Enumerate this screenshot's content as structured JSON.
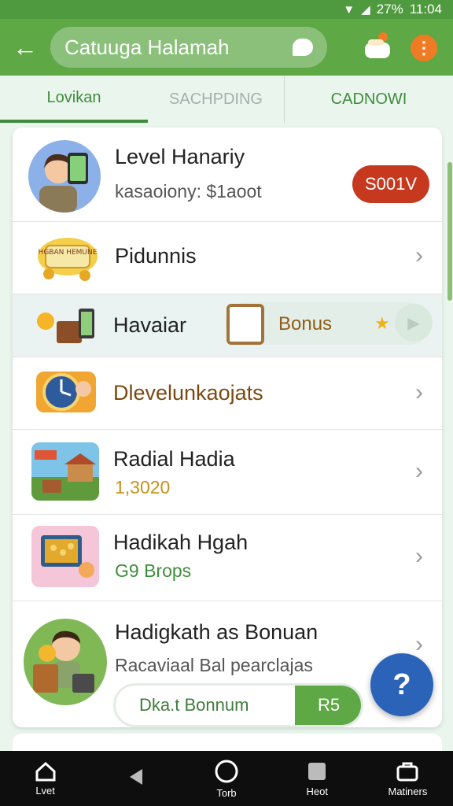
{
  "status_bar": {
    "battery": "27%",
    "time": "11:04"
  },
  "app_bar": {
    "search_text": "Catuuga Halamah"
  },
  "tabs": [
    {
      "label": "Lovikan"
    },
    {
      "label": "SACHPDING"
    },
    {
      "label": "CADNOWI"
    }
  ],
  "rows": [
    {
      "title": "Level Hanariy",
      "subtitle": "kasaoiony: $1aoot",
      "badge": "S001V"
    },
    {
      "title": "Pidunnis"
    },
    {
      "title": "Havaiar",
      "bonus_label": "Bonus"
    },
    {
      "title": "Dlevelunkaojats"
    },
    {
      "title": "Radial Hadia",
      "subtitle": "1,3020"
    },
    {
      "title": "Hadikah Hgah",
      "subtitle": "G9 Brops"
    },
    {
      "title": "Hadigkath as Bonuan",
      "subtitle": "Racaviaal Bal pearclajas",
      "claim_label": "Dka.t Bonnum",
      "claim_count": "R5"
    }
  ],
  "thumb_text": "HGBAN HEMUNE",
  "bottom_nav": [
    {
      "label": "Lvet"
    },
    {
      "label": ""
    },
    {
      "label": "Torb"
    },
    {
      "label": "Heot"
    },
    {
      "label": "Matiners"
    }
  ],
  "colors": {
    "primary_green": "#5ea846",
    "badge_red": "#c6391f",
    "fab_blue": "#2b63b9",
    "accent_orange": "#ef7c24"
  },
  "icons": {
    "status": [
      "wifi-icon",
      "signal-icon",
      "battery-icon"
    ],
    "app_bar": [
      "back-arrow-icon",
      "chat-bubble-icon",
      "gift-icon",
      "more-vert-icon"
    ],
    "fab": "help-icon",
    "nav": [
      "home-icon",
      "back-triangle-icon",
      "circle-home-icon",
      "square-recents-icon",
      "bag-icon"
    ]
  }
}
